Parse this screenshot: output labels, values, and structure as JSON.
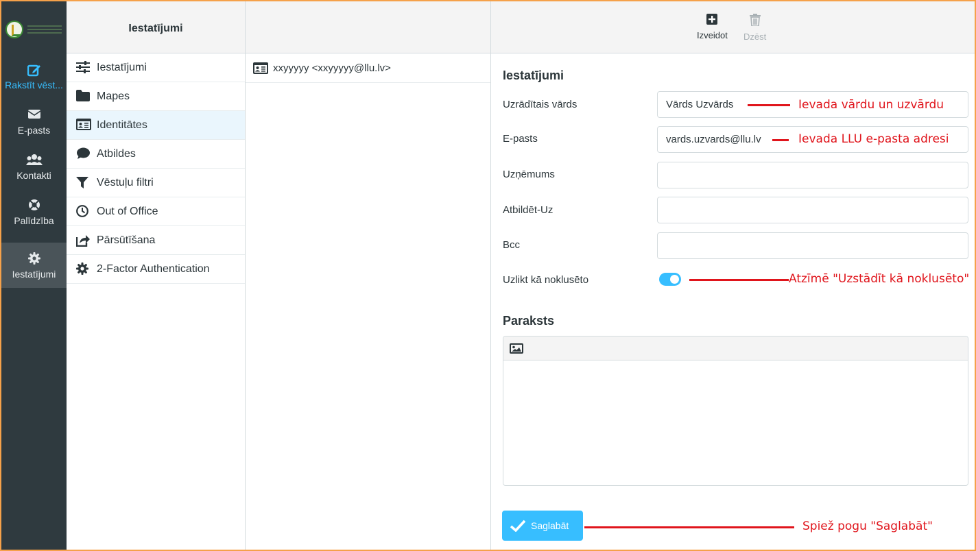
{
  "colors": {
    "accent": "#37beff",
    "nav_bg": "#2f3a3f",
    "annotation": "#e0151c"
  },
  "nav": {
    "items": [
      {
        "label": "Rakstīt vēst...",
        "icon": "compose-icon"
      },
      {
        "label": "E-pasts",
        "icon": "envelope-icon"
      },
      {
        "label": "Kontakti",
        "icon": "users-icon"
      },
      {
        "label": "Palīdzība",
        "icon": "lifebuoy-icon"
      },
      {
        "label": "Iestatījumi",
        "icon": "gear-icon"
      }
    ]
  },
  "settings_column": {
    "title": "Iestatījumi",
    "items": [
      {
        "label": "Iestatījumi",
        "icon": "sliders-icon"
      },
      {
        "label": "Mapes",
        "icon": "folder-icon"
      },
      {
        "label": "Identitātes",
        "icon": "id-card-icon"
      },
      {
        "label": "Atbildes",
        "icon": "comment-icon"
      },
      {
        "label": "Vēstuļu filtri",
        "icon": "filter-icon"
      },
      {
        "label": "Out of Office",
        "icon": "clock-icon"
      },
      {
        "label": "Pārsūtīšana",
        "icon": "forward-icon"
      },
      {
        "label": "2-Factor Authentication",
        "icon": "gear-icon"
      }
    ]
  },
  "identities_column": {
    "title": "",
    "items": [
      {
        "label": "xxyyyyy <xxyyyyy@llu.lv>",
        "icon": "id-card-icon"
      }
    ]
  },
  "toolbar": {
    "create_label": "Izveidot",
    "delete_label": "Dzēst"
  },
  "form": {
    "section_title": "Iestatījumi",
    "display_name_label": "Uzrādītais vārds",
    "display_name_value": "Vārds Uzvārds",
    "email_label": "E-pasts",
    "email_value": "vards.uzvards@llu.lv",
    "company_label": "Uzņēmums",
    "company_value": "",
    "reply_to_label": "Atbildēt-Uz",
    "reply_to_value": "",
    "bcc_label": "Bcc",
    "bcc_value": "",
    "default_label": "Uzlikt kā noklusēto",
    "default_checked": true,
    "signature_title": "Paraksts",
    "save_label": "Saglabāt"
  },
  "annotations": {
    "name": "Ievada vārdu un uzvārdu",
    "email": "Ievada LLU e-pasta adresi",
    "default": "Atzīmē \"Uzstādīt kā noklusēto\"",
    "save": "Spiež pogu \"Saglabāt\""
  }
}
